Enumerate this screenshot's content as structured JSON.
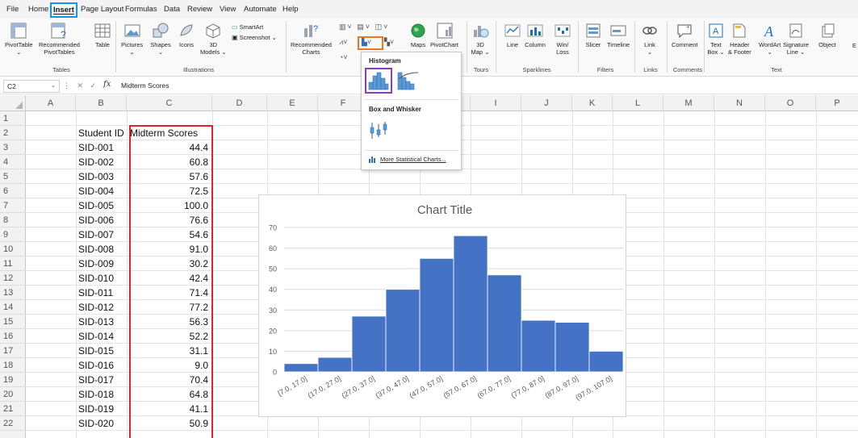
{
  "menu": {
    "tabs": [
      "File",
      "Home",
      "Insert",
      "Page Layout",
      "Formulas",
      "Data",
      "Review",
      "View",
      "Automate",
      "Help"
    ],
    "active_tab": "Insert"
  },
  "ribbon": {
    "pivottable": "PivotTable",
    "recommended_pivottables_1": "Recommended",
    "recommended_pivottables_2": "PivotTables",
    "table": "Table",
    "group_tables": "Tables",
    "pictures": "Pictures",
    "shapes": "Shapes",
    "icons": "Icons",
    "models_1": "3D",
    "models_2": "Models",
    "smartart": "SmartArt",
    "screenshot": "Screenshot",
    "group_illustrations": "Illustrations",
    "recommended_charts_1": "Recommended",
    "recommended_charts_2": "Charts",
    "maps": "Maps",
    "pivotchart": "PivotChart",
    "map3d_1": "3D",
    "map3d_2": "Map",
    "group_tours": "Tours",
    "line": "Line",
    "column": "Column",
    "winloss_1": "Win/",
    "winloss_2": "Loss",
    "group_sparklines": "Sparklines",
    "slicer": "Slicer",
    "timeline": "Timeline",
    "group_filters": "Filters",
    "link": "Link",
    "group_links": "Links",
    "comment": "Comment",
    "group_comments": "Comments",
    "textbox_1": "Text",
    "textbox_2": "Box",
    "header_1": "Header",
    "header_2": "& Footer",
    "wordart": "WordArt",
    "signature_1": "Signature",
    "signature_2": "Line",
    "object": "Object",
    "group_text": "Text",
    "cut_off": "E"
  },
  "formula_bar": {
    "name_box": "C2",
    "fx": "fx",
    "content": "Midterm Scores"
  },
  "columns": [
    "A",
    "B",
    "C",
    "D",
    "E",
    "F",
    "G",
    "H",
    "I",
    "J",
    "K",
    "L",
    "M",
    "N",
    "O",
    "P"
  ],
  "rows": [
    "1",
    "2",
    "3",
    "4",
    "5",
    "6",
    "7",
    "8",
    "9",
    "10",
    "11",
    "12",
    "13",
    "14",
    "15",
    "16",
    "17",
    "18",
    "19",
    "20",
    "21",
    "22"
  ],
  "sheet": {
    "header_b": "Student ID",
    "header_c": "Midterm Scores",
    "student_ids": [
      "SID-001",
      "SID-002",
      "SID-003",
      "SID-004",
      "SID-005",
      "SID-006",
      "SID-007",
      "SID-008",
      "SID-009",
      "SID-010",
      "SID-011",
      "SID-012",
      "SID-013",
      "SID-014",
      "SID-015",
      "SID-016",
      "SID-017",
      "SID-018",
      "SID-019",
      "SID-020"
    ],
    "scores": [
      "44.4",
      "60.8",
      "57.6",
      "72.5",
      "100.0",
      "76.6",
      "54.6",
      "91.0",
      "30.2",
      "42.4",
      "71.4",
      "77.2",
      "56.3",
      "52.2",
      "31.1",
      "9.0",
      "70.4",
      "64.8",
      "41.1",
      "50.9"
    ]
  },
  "dropdown": {
    "histogram_label": "Histogram",
    "box_whisker_label": "Box and Whisker",
    "more_label": "More Statistical Charts..."
  },
  "colors": {
    "bar": "#4472c4",
    "insert_tab_highlight": "#1296e0",
    "ribbon_button_highlight": "#f07522",
    "histogram_option_highlight": "#8b3fb4",
    "column_highlight": "#e5202e"
  },
  "chart_data": {
    "type": "bar",
    "title": "Chart Title",
    "categories": [
      "[7.0, 17.0]",
      "(17.0, 27.0]",
      "(27.0, 37.0]",
      "(37.0, 47.0]",
      "(47.0, 57.0]",
      "(57.0, 67.0]",
      "(67.0, 77.0]",
      "(77.0, 87.0]",
      "(87.0, 97.0]",
      "(97.0, 107.0]"
    ],
    "values": [
      4,
      7,
      27,
      40,
      55,
      66,
      47,
      25,
      24,
      10
    ],
    "yticks": [
      "0",
      "10",
      "20",
      "30",
      "40",
      "50",
      "60",
      "70"
    ],
    "ylim": [
      0,
      70
    ],
    "grid": true,
    "legend": "none"
  }
}
